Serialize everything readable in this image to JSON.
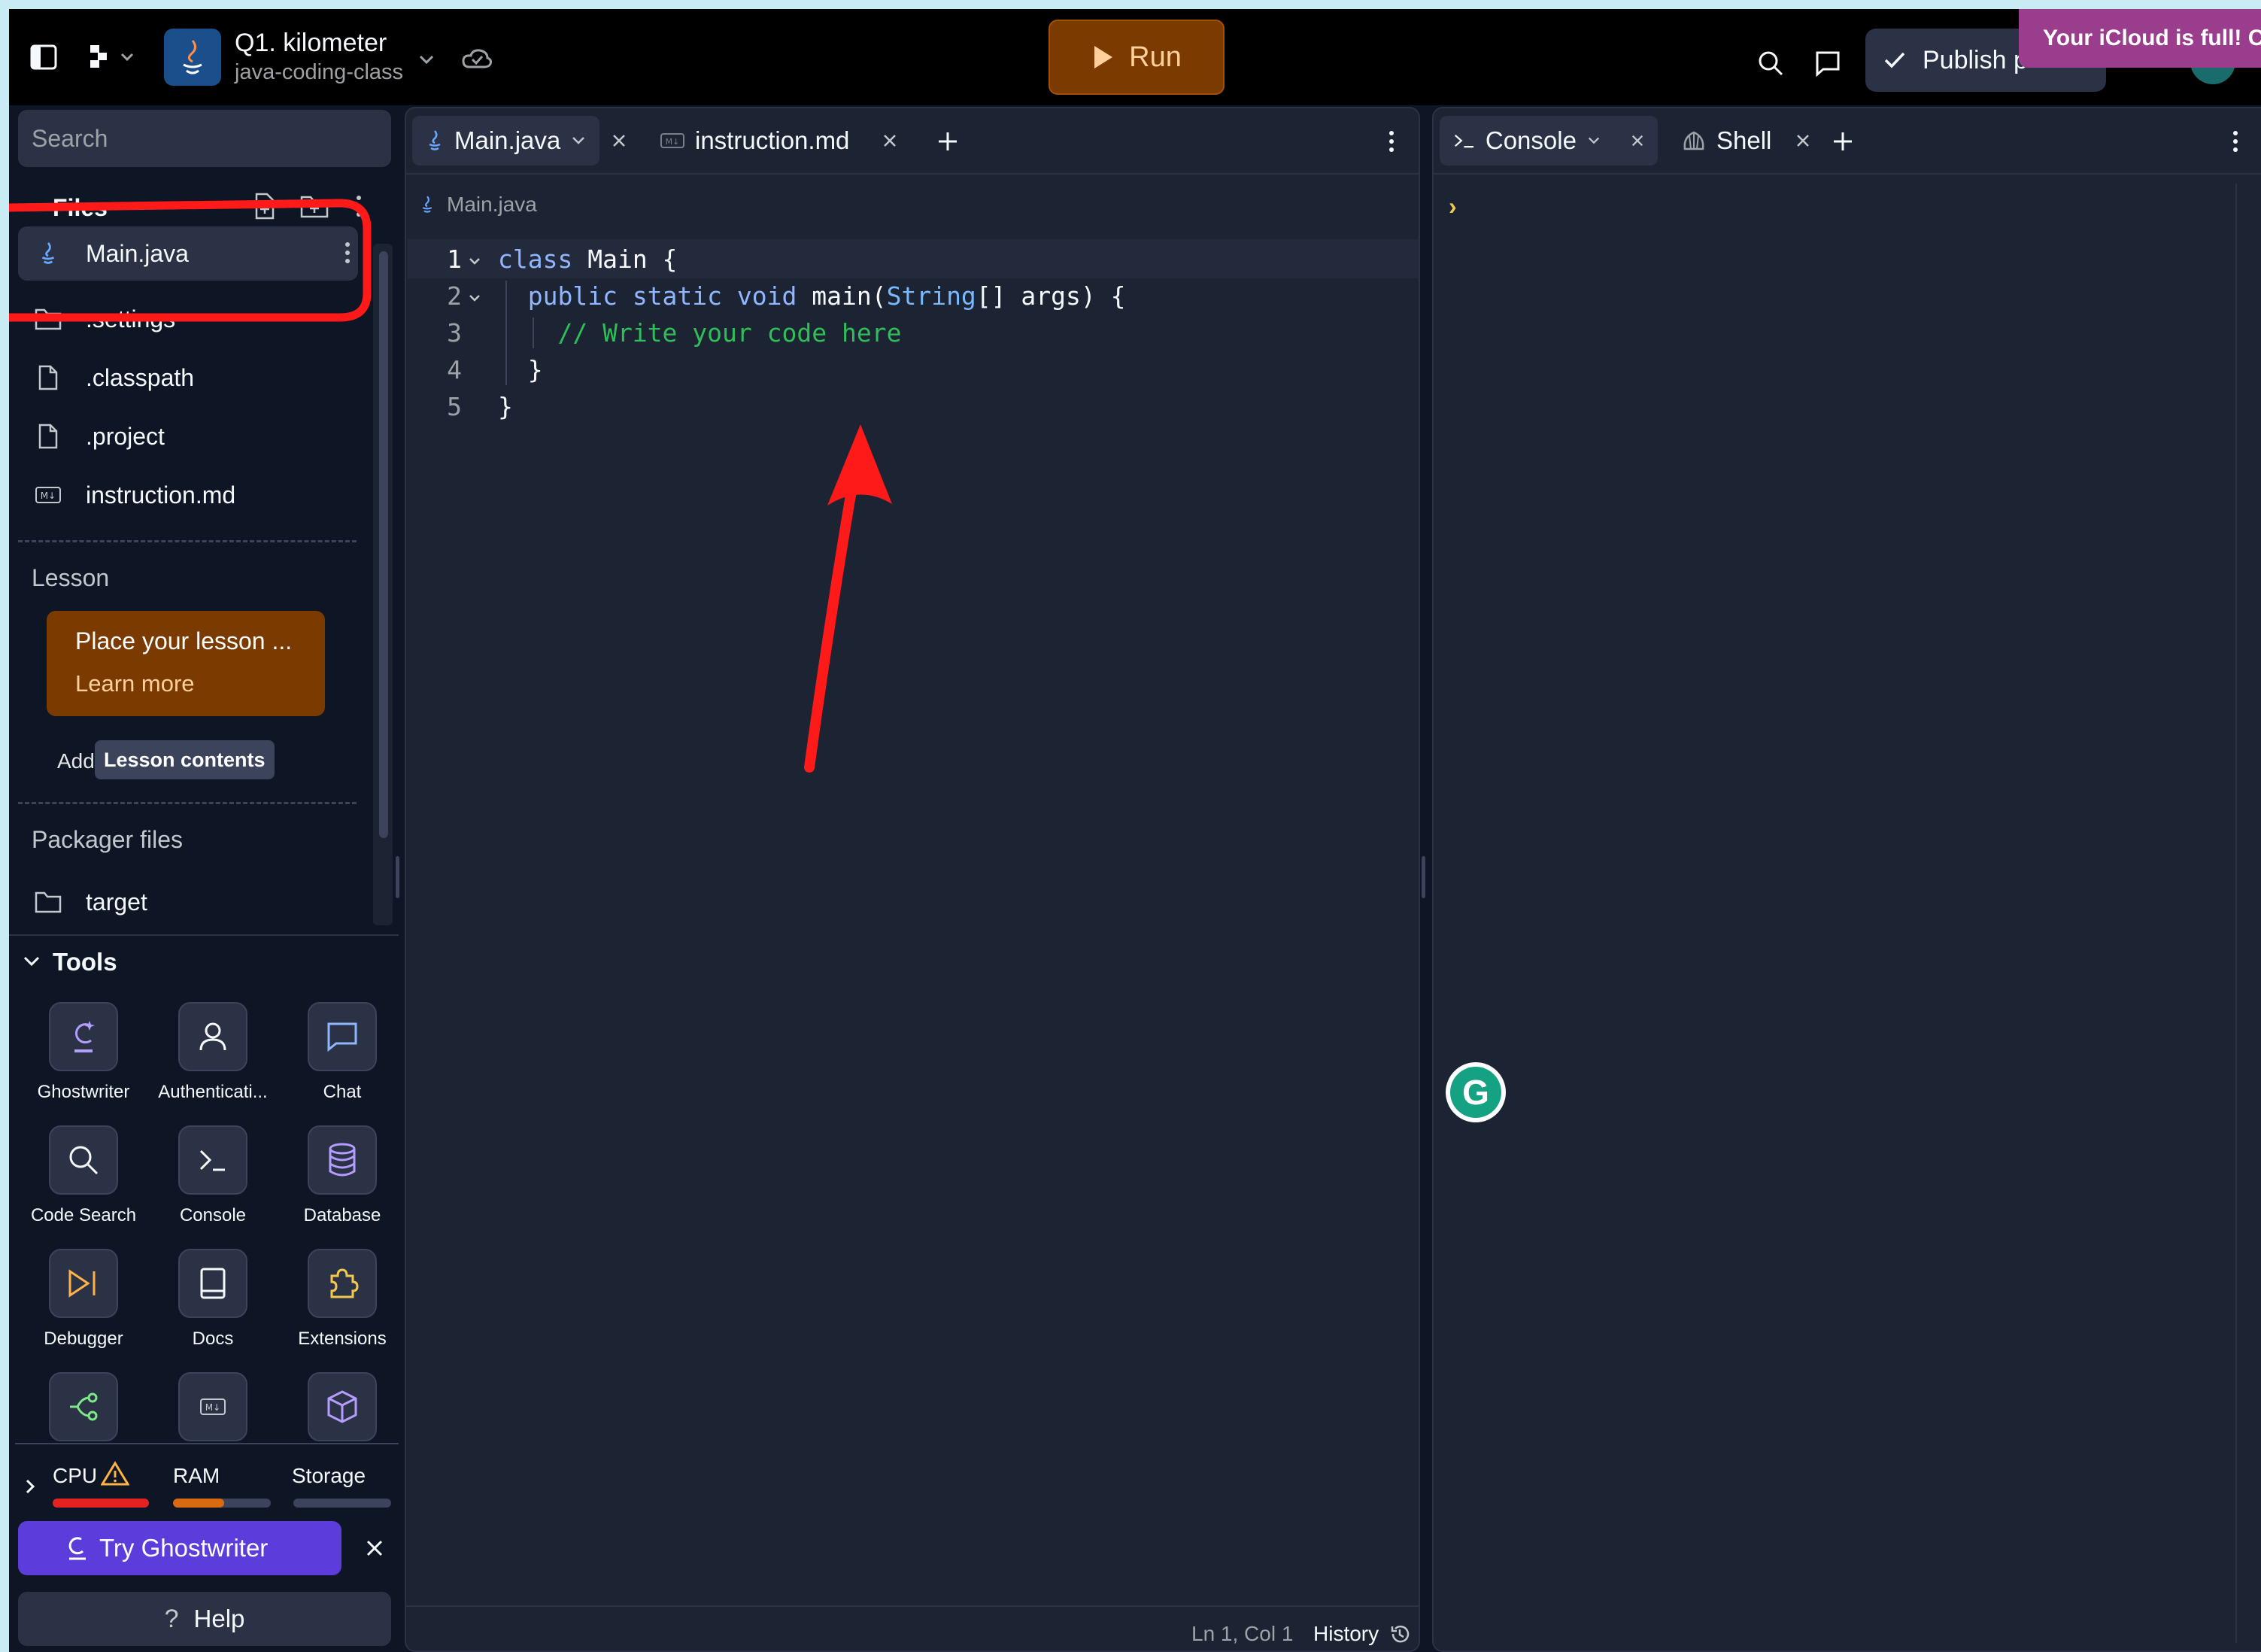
{
  "header": {
    "repl_title": "Q1. kilometer",
    "repl_subtitle": "java-coding-class",
    "run_label": "Run",
    "publish_label": "Publish p",
    "icloud_banner": "Your iCloud is full! C"
  },
  "sidebar": {
    "search_placeholder": "Search",
    "files_label": "Files",
    "files": [
      {
        "name": "Main.java",
        "icon": "java-icon"
      },
      {
        "name": ".settings",
        "icon": "folder-icon"
      },
      {
        "name": ".classpath",
        "icon": "file-icon"
      },
      {
        "name": ".project",
        "icon": "file-icon"
      },
      {
        "name": "instruction.md",
        "icon": "markdown-icon"
      }
    ],
    "lesson_label": "Lesson",
    "lesson_card_title": "Place your lesson ...",
    "lesson_card_link": "Learn more",
    "add_label": "Add",
    "lesson_tooltip": "Lesson contents",
    "packager_label": "Packager files",
    "packager_items": [
      {
        "name": "target",
        "icon": "folder-icon"
      }
    ],
    "tools_label": "Tools",
    "tools": [
      {
        "label": "Ghostwriter",
        "icon": "ghostwriter-icon"
      },
      {
        "label": "Authenticati...",
        "icon": "user-icon"
      },
      {
        "label": "Chat",
        "icon": "chat-icon"
      },
      {
        "label": "Code Search",
        "icon": "search-icon"
      },
      {
        "label": "Console",
        "icon": "terminal-icon"
      },
      {
        "label": "Database",
        "icon": "database-icon"
      },
      {
        "label": "Debugger",
        "icon": "debugger-icon"
      },
      {
        "label": "Docs",
        "icon": "book-icon"
      },
      {
        "label": "Extensions",
        "icon": "puzzle-icon"
      },
      {
        "label": "",
        "icon": "git-icon"
      },
      {
        "label": "",
        "icon": "markdown-icon"
      },
      {
        "label": "",
        "icon": "package-icon"
      }
    ],
    "resources": {
      "cpu_label": "CPU",
      "ram_label": "RAM",
      "storage_label": "Storage",
      "cpu_fraction": 1.0,
      "ram_fraction": 0.52,
      "storage_fraction": 0.0
    },
    "try_ghostwriter_label": "Try Ghostwriter",
    "help_label": "Help"
  },
  "editor": {
    "tabs": [
      {
        "label": "Main.java",
        "active": true
      },
      {
        "label": "instruction.md",
        "active": false
      }
    ],
    "breadcrumb": "Main.java",
    "lines": [
      {
        "num": "1",
        "tokens": [
          [
            "kw",
            "class"
          ],
          [
            "pl",
            " Main {"
          ]
        ]
      },
      {
        "num": "2",
        "tokens": [
          [
            "pl",
            "  "
          ],
          [
            "kw",
            "public static void"
          ],
          [
            "pl",
            " main("
          ],
          [
            "ty",
            "String"
          ],
          [
            "pl",
            "[] args) {"
          ]
        ]
      },
      {
        "num": "3",
        "tokens": [
          [
            "pl",
            "    "
          ],
          [
            "cm",
            "// Write your code here"
          ]
        ]
      },
      {
        "num": "4",
        "tokens": [
          [
            "pl",
            "  }"
          ]
        ]
      },
      {
        "num": "5",
        "tokens": [
          [
            "pl",
            "}"
          ]
        ]
      }
    ],
    "status_position": "Ln 1, Col 1",
    "history_label": "History"
  },
  "console": {
    "tabs": [
      {
        "label": "Console",
        "active": true
      },
      {
        "label": "Shell",
        "active": false
      }
    ],
    "prompt_glyph": "›"
  },
  "colors": {
    "run_button": "#7a3a00",
    "run_text": "#ffcf9c",
    "annotation_red": "#ff1a1a",
    "ghostwriter_purple": "#5c3ddb",
    "lesson_card": "#7a3a00",
    "icloud_banner": "#9b3d8d"
  }
}
